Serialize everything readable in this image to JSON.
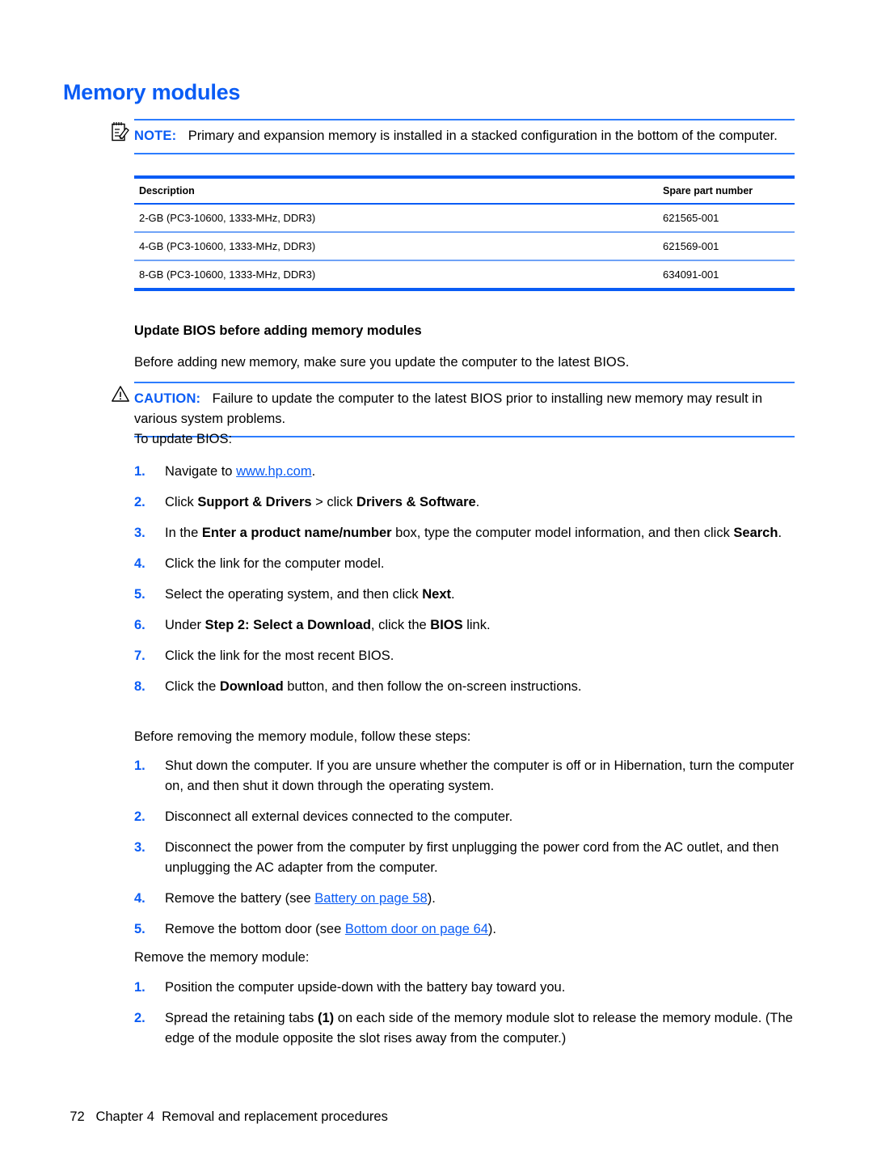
{
  "heading": "Memory modules",
  "note": {
    "icon": "note-pad-pencil-icon",
    "label": "NOTE:",
    "text": "Primary and expansion memory is installed in a stacked configuration in the bottom of the computer."
  },
  "table": {
    "headers": [
      "Description",
      "Spare part number"
    ],
    "rows": [
      {
        "description": "2-GB (PC3-10600, 1333-MHz, DDR3)",
        "spare_part_number": "621565-001"
      },
      {
        "description": "4-GB (PC3-10600, 1333-MHz, DDR3)",
        "spare_part_number": "621569-001"
      },
      {
        "description": "8-GB (PC3-10600, 1333-MHz, DDR3)",
        "spare_part_number": "634091-001"
      }
    ]
  },
  "bios_section": {
    "heading": "Update BIOS before adding memory modules",
    "intro": "Before adding new memory, make sure you update the computer to the latest BIOS.",
    "caution": {
      "icon": "warning-triangle-icon",
      "label": "CAUTION:",
      "text": "Failure to update the computer to the latest BIOS prior to installing new memory may result in various system problems."
    },
    "lead_in": "To update BIOS:",
    "steps": [
      {
        "num": "1.",
        "parts": [
          {
            "t": "Navigate to ",
            "style": "normal"
          },
          {
            "t": "www.hp.com",
            "style": "link"
          },
          {
            "t": ".",
            "style": "normal"
          }
        ]
      },
      {
        "num": "2.",
        "parts": [
          {
            "t": "Click ",
            "style": "normal"
          },
          {
            "t": "Support & Drivers",
            "style": "bold"
          },
          {
            "t": " > click ",
            "style": "normal"
          },
          {
            "t": "Drivers & Software",
            "style": "bold"
          },
          {
            "t": ".",
            "style": "normal"
          }
        ]
      },
      {
        "num": "3.",
        "parts": [
          {
            "t": "In the ",
            "style": "normal"
          },
          {
            "t": "Enter a product name/number",
            "style": "bold"
          },
          {
            "t": " box, type the computer model information, and then click ",
            "style": "normal"
          },
          {
            "t": "Search",
            "style": "bold"
          },
          {
            "t": ".",
            "style": "normal"
          }
        ]
      },
      {
        "num": "4.",
        "parts": [
          {
            "t": "Click the link for the computer model.",
            "style": "normal"
          }
        ]
      },
      {
        "num": "5.",
        "parts": [
          {
            "t": "Select the operating system, and then click ",
            "style": "normal"
          },
          {
            "t": "Next",
            "style": "bold"
          },
          {
            "t": ".",
            "style": "normal"
          }
        ]
      },
      {
        "num": "6.",
        "parts": [
          {
            "t": "Under ",
            "style": "normal"
          },
          {
            "t": "Step 2: Select a Download",
            "style": "bold"
          },
          {
            "t": ", click the ",
            "style": "normal"
          },
          {
            "t": "BIOS",
            "style": "bold"
          },
          {
            "t": " link.",
            "style": "normal"
          }
        ]
      },
      {
        "num": "7.",
        "parts": [
          {
            "t": "Click the link for the most recent BIOS.",
            "style": "normal"
          }
        ]
      },
      {
        "num": "8.",
        "parts": [
          {
            "t": "Click the ",
            "style": "normal"
          },
          {
            "t": "Download",
            "style": "bold"
          },
          {
            "t": " button, and then follow the on-screen instructions.",
            "style": "normal"
          }
        ]
      }
    ]
  },
  "before_removing": {
    "lead_in": "Before removing the memory module, follow these steps:",
    "steps": [
      {
        "num": "1.",
        "parts": [
          {
            "t": "Shut down the computer. If you are unsure whether the computer is off or in Hibernation, turn the computer on, and then shut it down through the operating system.",
            "style": "normal"
          }
        ]
      },
      {
        "num": "2.",
        "parts": [
          {
            "t": "Disconnect all external devices connected to the computer.",
            "style": "normal"
          }
        ]
      },
      {
        "num": "3.",
        "parts": [
          {
            "t": "Disconnect the power from the computer by first unplugging the power cord from the AC outlet, and then unplugging the AC adapter from the computer.",
            "style": "normal"
          }
        ]
      },
      {
        "num": "4.",
        "parts": [
          {
            "t": "Remove the battery (see ",
            "style": "normal"
          },
          {
            "t": "Battery on page 58",
            "style": "link"
          },
          {
            "t": ").",
            "style": "normal"
          }
        ]
      },
      {
        "num": "5.",
        "parts": [
          {
            "t": "Remove the bottom door (see ",
            "style": "normal"
          },
          {
            "t": "Bottom door on page 64",
            "style": "link"
          },
          {
            "t": ").",
            "style": "normal"
          }
        ]
      }
    ]
  },
  "remove_module": {
    "lead_in": "Remove the memory module:",
    "steps": [
      {
        "num": "1.",
        "parts": [
          {
            "t": "Position the computer upside-down with the battery bay toward you.",
            "style": "normal"
          }
        ]
      },
      {
        "num": "2.",
        "parts": [
          {
            "t": "Spread the retaining tabs ",
            "style": "normal"
          },
          {
            "t": "(1)",
            "style": "bold"
          },
          {
            "t": " on each side of the memory module slot to release the memory module. (The edge of the module opposite the slot rises away from the computer.)",
            "style": "normal"
          }
        ]
      }
    ]
  },
  "footer": {
    "page_number": "72",
    "chapter": "Chapter 4",
    "title": "Removal and replacement procedures"
  },
  "colors": {
    "accent_blue": "#0a5cf5",
    "rule_blue_light": "#6fa3f7",
    "text_black": "#000000"
  }
}
